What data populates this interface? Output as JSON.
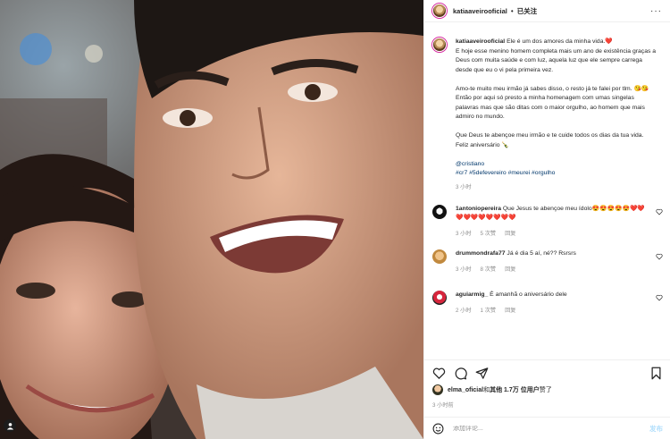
{
  "post": {
    "username": "katiaaveirooficial",
    "dot": "•",
    "follow_label": "已关注",
    "more_label": "···"
  },
  "caption": {
    "username": "katiaaveirooficial",
    "p1_text": "Ele é um dos amores da minha vida.❤️\nE hoje esse menino homem completa mais um ano de existência graças a Deus com muita saúde e com luz, aquela luz que ele sempre carrega desde que eu o vi pela primeira vez.",
    "p2": "Amo-te muito meu irmão já sabes disso, o resto já te falei por tlm. 😘😘\nEntão por aqui só presto a minha homenagem com umas singelas palavras mas que são ditas com o maior orgulho, ao homem que mais admiro no mundo.",
    "p3": "Que Deus te abençoe meu irmão e te cuide todos os dias da tua vida.\nFeliz aniversário 🍾",
    "mention": "@cristiano",
    "hashtags": "#cr7 #5defevereiro #meurei #orgulho",
    "time": "3 小时"
  },
  "comments": [
    {
      "username": "1antoniopereira",
      "text": "Que Jesus te abençoe meu ídolo😍😍😍😍😍❤️❤️❤️❤️❤️❤️❤️❤️❤️❤️",
      "time": "3 小时",
      "likes": "5 次赞",
      "reply": "回复"
    },
    {
      "username": "drummondrafa77",
      "text": "Já é dia 5 aí, né?? Rsrsrs",
      "time": "3 小时",
      "likes": "8 次赞",
      "reply": "回复"
    },
    {
      "username": "aguiarmig_",
      "text": "É amanhã o aniversário dele",
      "time": "2 小时",
      "likes": "1 次赞",
      "reply": "回复"
    }
  ],
  "likes": {
    "username": "elma_oficial",
    "text_mid": " 和 ",
    "others": "其他 1.7万 位用户",
    "text_end": " 赞了"
  },
  "post_time": "3 小时前",
  "add_comment": {
    "placeholder": "添加评论...",
    "post_label": "发布"
  },
  "icons": {
    "like": "heart-icon",
    "comment": "comment-icon",
    "share": "paper-plane-icon",
    "save": "bookmark-icon",
    "emoji": "smiley-icon",
    "tagged": "person-icon"
  },
  "colors": {
    "link": "#00376b",
    "muted": "#8e8e8e",
    "text": "#262626",
    "post_button": "#b2dffc"
  }
}
